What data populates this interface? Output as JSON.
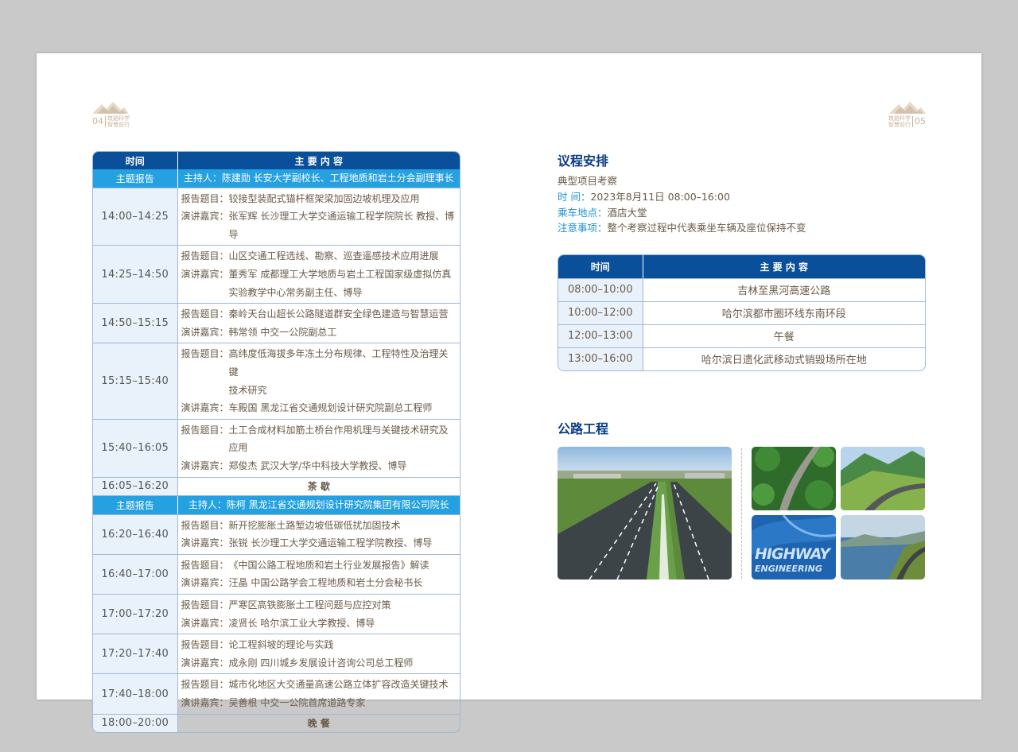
{
  "left_page": {
    "page_number": "04",
    "slogan": [
      "筑路科学",
      "智慧前行"
    ],
    "headers": {
      "time": "时间",
      "content": "主 要 内 容"
    },
    "rows": [
      {
        "kind": "section",
        "time": "主题报告",
        "content": "主持人：陈建勋  长安大学副校长、工程地质和岩土分会副理事长"
      },
      {
        "kind": "talk",
        "time": "14:00–14:25",
        "lines": [
          {
            "label": "报告题目：",
            "text": "铰接型装配式锚杆框架梁加固边坡机理及应用"
          },
          {
            "label": "演讲嘉宾：",
            "text": "张军辉  长沙理工大学交通运输工程学院院长 教授、博导"
          }
        ]
      },
      {
        "kind": "talk",
        "time": "14:25–14:50",
        "lines": [
          {
            "label": "报告题目：",
            "text": "山区交通工程选线、勘察、巡查遥感技术应用进展"
          },
          {
            "label": "演讲嘉宾：",
            "text": "董秀军  成都理工大学地质与岩土工程国家级虚拟仿真"
          },
          {
            "label": "",
            "text": "实验教学中心常务副主任、博导"
          }
        ]
      },
      {
        "kind": "talk",
        "time": "14:50–15:15",
        "lines": [
          {
            "label": "报告题目：",
            "text": "秦岭天台山超长公路隧道群安全绿色建造与智慧运营"
          },
          {
            "label": "演讲嘉宾：",
            "text": "韩常领  中交一公院副总工"
          }
        ]
      },
      {
        "kind": "talk",
        "time": "15:15–15:40",
        "lines": [
          {
            "label": "报告题目：",
            "text": "高纬度低海拔多年冻土分布规律、工程特性及治理关键"
          },
          {
            "label": "",
            "text": "技术研究"
          },
          {
            "label": "演讲嘉宾：",
            "text": "车殿国  黑龙江省交通规划设计研究院副总工程师"
          }
        ]
      },
      {
        "kind": "talk",
        "time": "15:40–16:05",
        "lines": [
          {
            "label": "报告题目：",
            "text": "土工合成材料加筋土桥台作用机理与关键技术研究及应用"
          },
          {
            "label": "演讲嘉宾：",
            "text": "郑俊杰  武汉大学/华中科技大学教授、博导"
          }
        ]
      },
      {
        "kind": "plain",
        "time": "16:05–16:20",
        "content": "茶  歇"
      },
      {
        "kind": "section",
        "time": "主题报告",
        "content": "主持人：陈柯    黑龙江省交通规划设计研究院集团有限公司院长"
      },
      {
        "kind": "talk",
        "time": "16:20–16:40",
        "lines": [
          {
            "label": "报告题目：",
            "text": "新开挖膨胀土路堑边坡低碳低扰加固技术"
          },
          {
            "label": "演讲嘉宾：",
            "text": "张锐  长沙理工大学交通运输工程学院教授、博导"
          }
        ]
      },
      {
        "kind": "talk",
        "time": "16:40–17:00",
        "lines": [
          {
            "label": "报告题目：",
            "text": "《中国公路工程地质和岩土行业发展报告》解读"
          },
          {
            "label": "演讲嘉宾：",
            "text": "汪晶  中国公路学会工程地质和岩土分会秘书长"
          }
        ]
      },
      {
        "kind": "talk",
        "time": "17:00–17:20",
        "lines": [
          {
            "label": "报告题目：",
            "text": "严寒区高铁膨胀土工程问题与应控对策"
          },
          {
            "label": "演讲嘉宾：",
            "text": "凌贤长  哈尔滨工业大学教授、博导"
          }
        ]
      },
      {
        "kind": "talk",
        "time": "17:20–17:40",
        "lines": [
          {
            "label": "报告题目：",
            "text": "论工程斜坡的理论与实践"
          },
          {
            "label": "演讲嘉宾：",
            "text": "成永刚  四川城乡发展设计咨询公司总工程师"
          }
        ]
      },
      {
        "kind": "talk",
        "time": "17:40–18:00",
        "lines": [
          {
            "label": "报告题目：",
            "text": "城市化地区大交通量高速公路立体扩容改造关键技术"
          },
          {
            "label": "演讲嘉宾：",
            "text": "吴善根  中交一公院首席道路专家"
          }
        ]
      },
      {
        "kind": "plain",
        "time": "18:00–20:00",
        "content": "晚  餐"
      }
    ]
  },
  "right_page": {
    "page_number": "05",
    "slogan": [
      "筑路科学",
      "智慧前行"
    ],
    "agenda_title": "议程安排",
    "subtitle": "典型项目考察",
    "info": [
      {
        "label": "时    间：",
        "value": "2023年8月11日 08:00–16:00"
      },
      {
        "label": "乘车地点：",
        "value": "酒店大堂"
      },
      {
        "label": "注意事项：",
        "value": "整个考察过程中代表乘坐车辆及座位保持不变"
      }
    ],
    "headers": {
      "time": "时间",
      "content": "主 要 内 容"
    },
    "visits": [
      {
        "time": "08:00–10:00",
        "content": "吉林至黑河高速公路"
      },
      {
        "time": "10:00–12:00",
        "content": "哈尔滨都市圈环线东南环段"
      },
      {
        "time": "12:00–13:00",
        "content": "午餐"
      },
      {
        "time": "13:00–16:00",
        "content": "哈尔滨日遗化武移动式销毁场所在地"
      }
    ],
    "highway_title": "公路工程",
    "photo_caption_1": "HIGHWAY",
    "photo_caption_2": "ENGINEERING",
    "colors": {
      "navy": "#0a4f9a",
      "sky": "#25a0e0",
      "pale": "#e9f2fa",
      "gold": "#c8b49a"
    }
  }
}
